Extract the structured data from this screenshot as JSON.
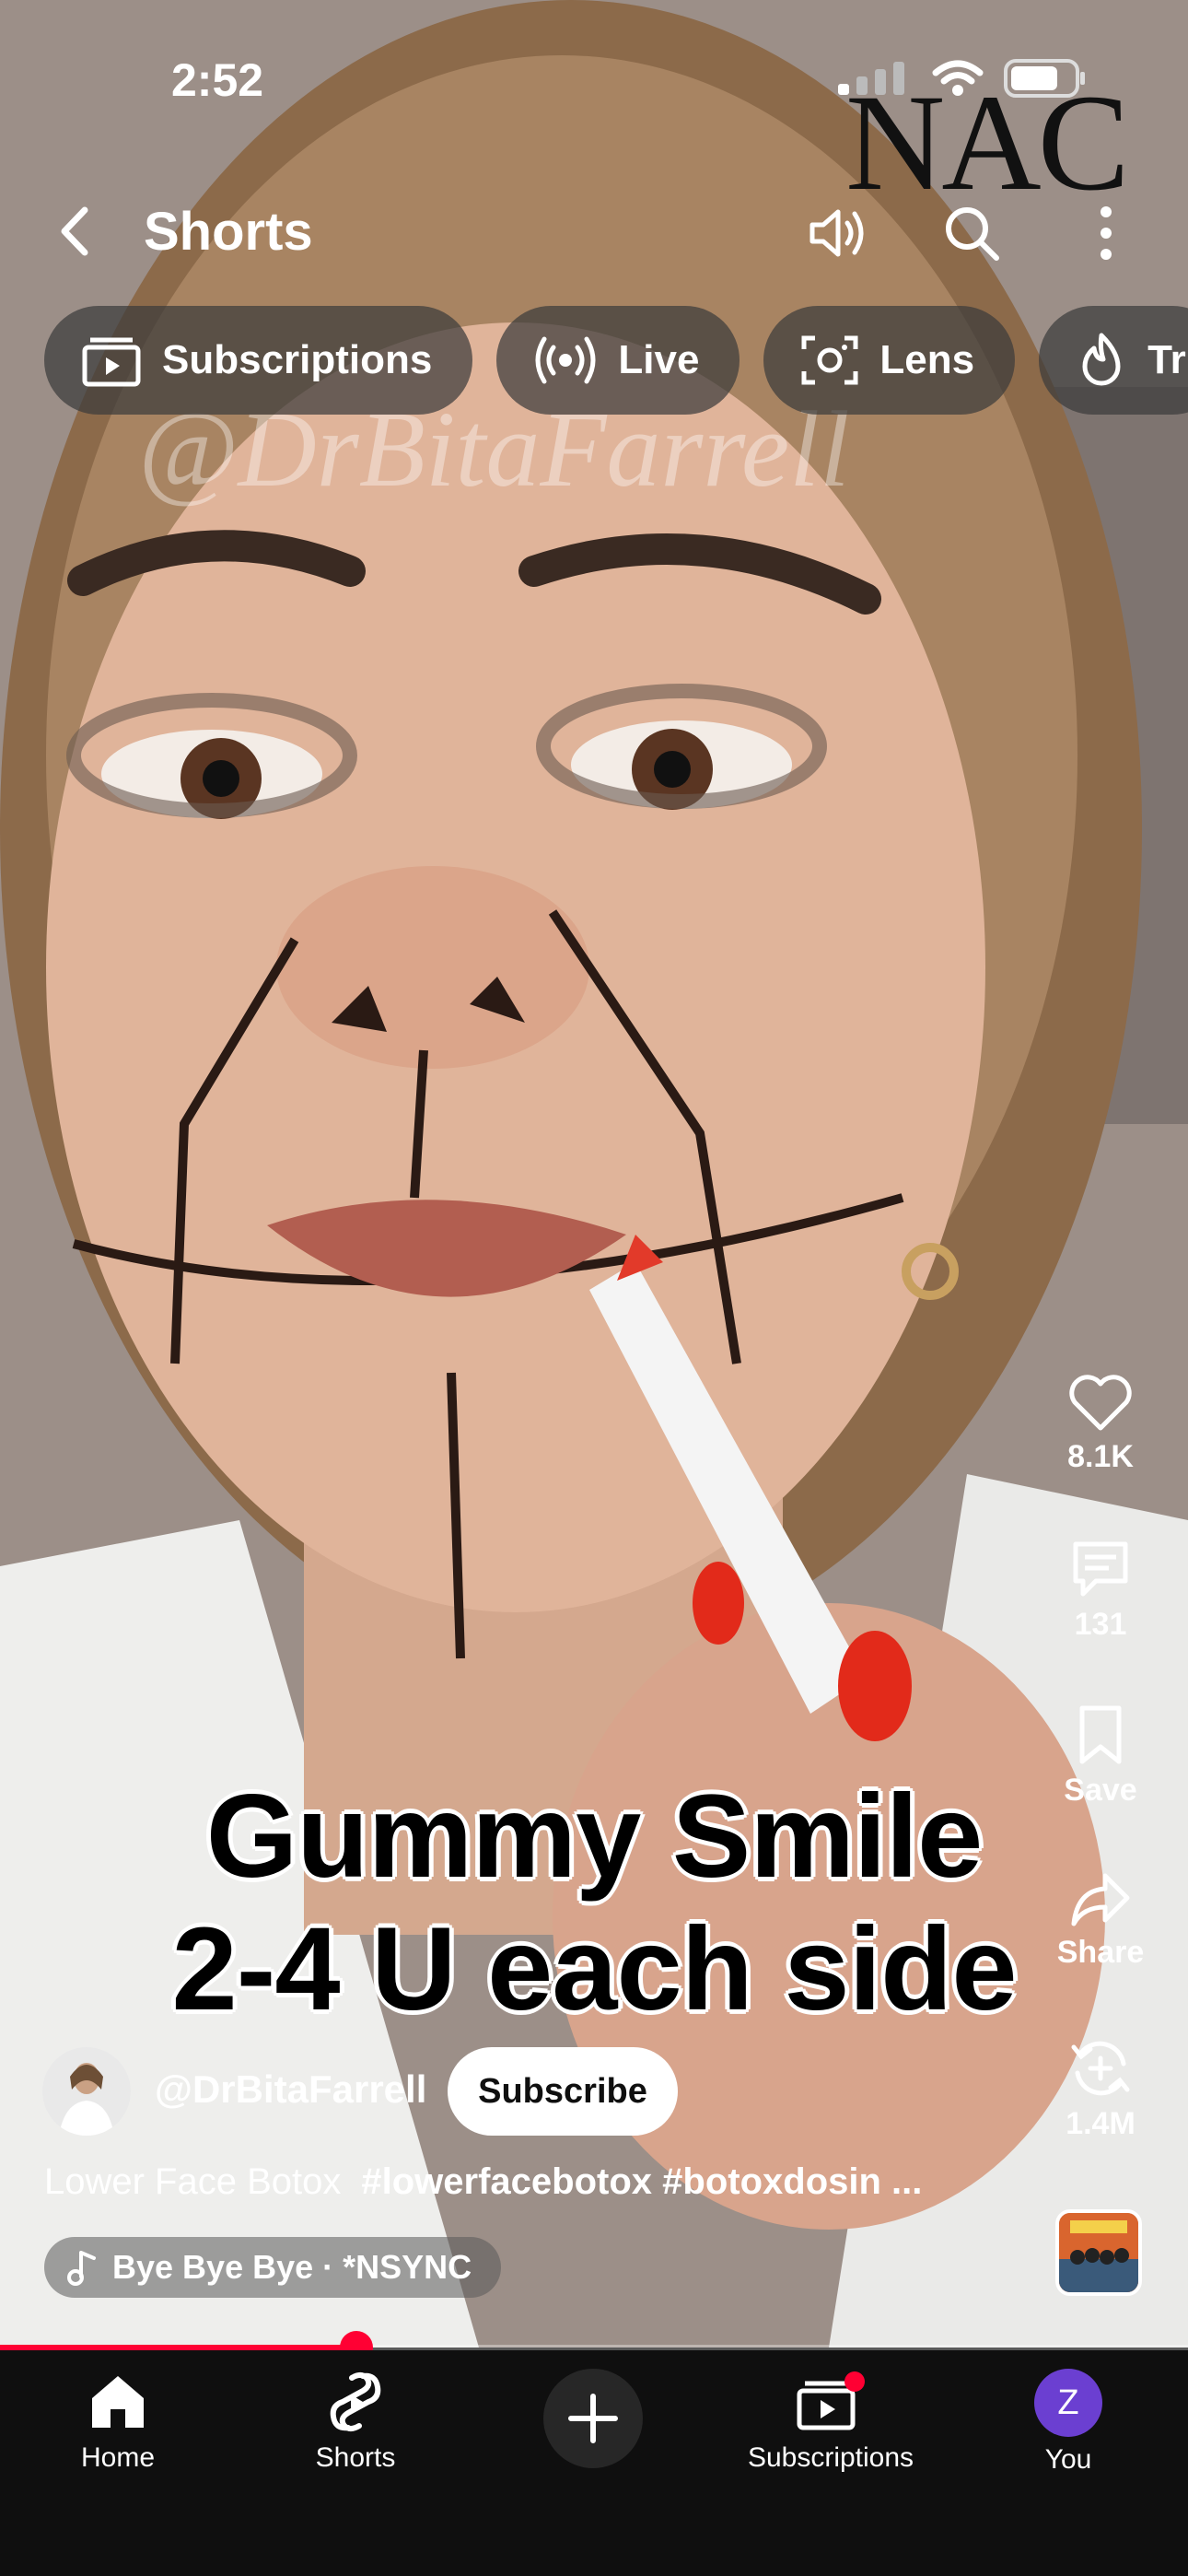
{
  "status_bar": {
    "time": "2:52"
  },
  "watermark": {
    "logo": "NAC",
    "handle": "@DrBitaFarrell"
  },
  "top_bar": {
    "title": "Shorts",
    "icons": [
      "back-arrow-icon",
      "volume-icon",
      "search-icon",
      "more-vert-icon"
    ]
  },
  "chips": [
    {
      "label": "Subscriptions",
      "icon": "subscriptions-icon"
    },
    {
      "label": "Live",
      "icon": "live-icon"
    },
    {
      "label": "Lens",
      "icon": "lens-icon"
    },
    {
      "label": "Tr",
      "icon": "trending-icon"
    }
  ],
  "caption": {
    "line1": "Gummy Smile",
    "line2": "2-4 U each side"
  },
  "actions": {
    "like": "8.1K",
    "comments": "131",
    "save": "Save",
    "share": "Share",
    "remix": "1.4M"
  },
  "channel": {
    "handle": "@DrBitaFarrell",
    "subscribe_label": "Subscribe"
  },
  "description": {
    "text": "Lower Face Botox",
    "hashtags": "#lowerfacebotox #botoxdosin ..."
  },
  "music": {
    "label": "Bye Bye Bye · *NSYNC"
  },
  "progress": {
    "fraction": 0.3
  },
  "bottom_nav": {
    "home": "Home",
    "shorts": "Shorts",
    "subscriptions": "Subscriptions",
    "you": "You",
    "you_initial": "Z"
  },
  "colors": {
    "accent": "#ff0033",
    "nav_bg": "#0f0f0f",
    "avatar_purple": "#6b3fd1"
  }
}
